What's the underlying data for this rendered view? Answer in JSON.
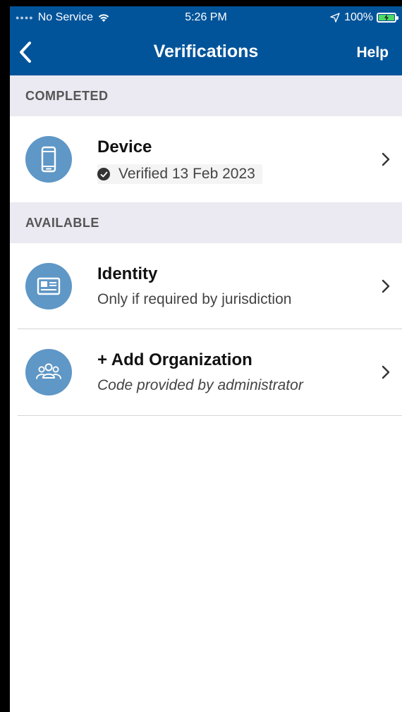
{
  "status_bar": {
    "carrier": "No Service",
    "time": "5:26 PM",
    "battery": "100%"
  },
  "nav": {
    "title": "Verifications",
    "help_label": "Help"
  },
  "sections": {
    "completed": {
      "header": "COMPLETED",
      "items": [
        {
          "title": "Device",
          "subtitle": "Verified 13 Feb 2023",
          "icon": "smartphone-icon"
        }
      ]
    },
    "available": {
      "header": "AVAILABLE",
      "items": [
        {
          "title": "Identity",
          "subtitle": "Only if required by jurisdiction",
          "icon": "id-card-icon"
        },
        {
          "title": "+ Add Organization",
          "subtitle": "Code provided by administrator",
          "icon": "group-icon"
        }
      ]
    }
  },
  "colors": {
    "nav_background": "#02549a",
    "section_background": "#ebe9f1",
    "icon_circle": "#5f97c6",
    "battery_fill": "#4cd964"
  }
}
